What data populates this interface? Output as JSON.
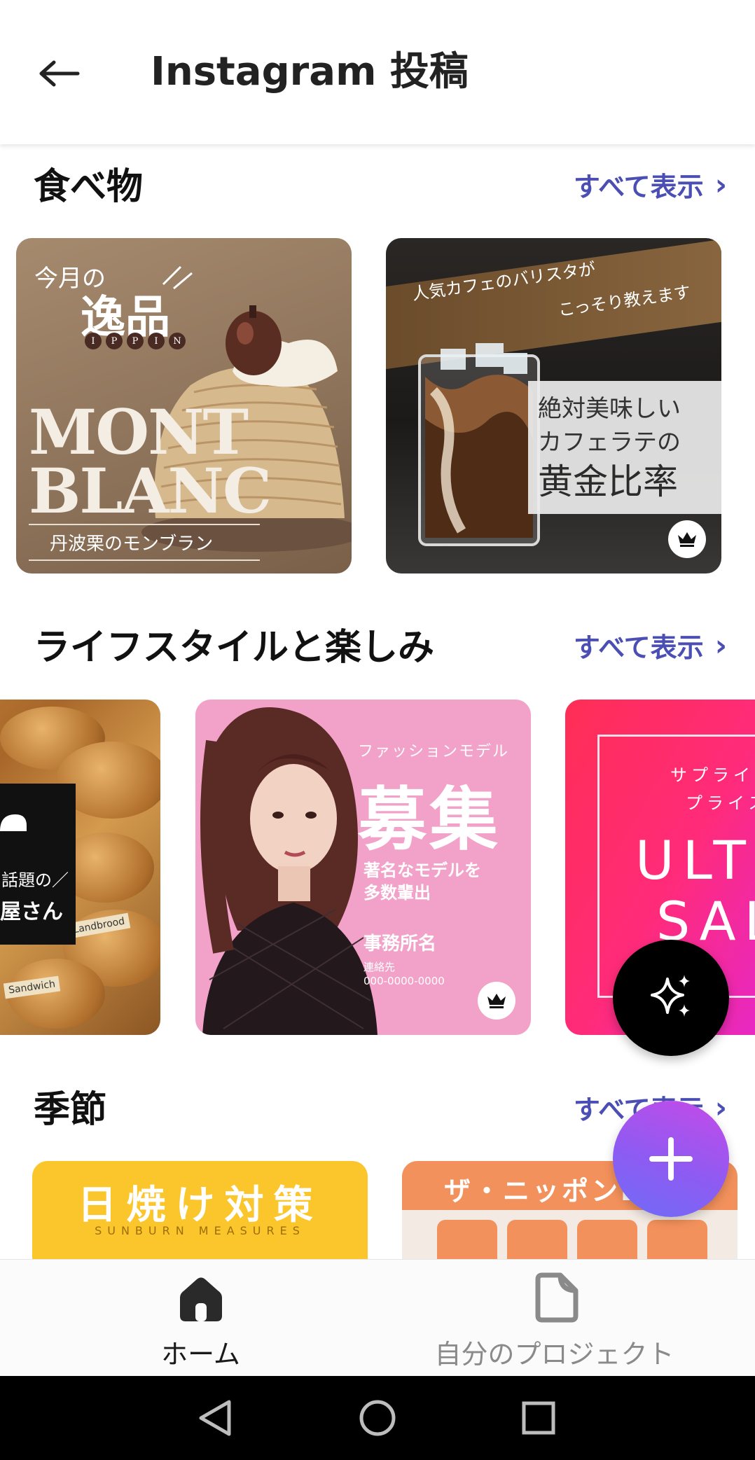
{
  "header": {
    "back_icon": "arrow-left-icon",
    "title": "Instagram 投稿"
  },
  "sections": [
    {
      "title": "食べ物",
      "see_all": "すべて表示",
      "cards": [
        {
          "kon": "今月の",
          "ippin": "逸品",
          "ippin_ro": [
            "I",
            "P",
            "P",
            "I",
            "N"
          ],
          "mont": "MONT",
          "blanc": "BLANC",
          "sub": "丹波栗のモンブラン",
          "premium": false
        },
        {
          "band_1": "人気カフェのバリスタが",
          "band_2": "こっそり教えます",
          "line_1": "絶対美味しい",
          "line_2": "カフェラテの",
          "line_3": "黄金比率",
          "premium": true
        }
      ]
    },
    {
      "title": "ライフスタイルと楽しみ",
      "see_all": "すべて表示",
      "cards": [
        {
          "line_1": "話題の／",
          "line_2": "屋さん",
          "bread_label_1": "Landbrood",
          "bread_label_2": "Sandwich",
          "premium": false
        },
        {
          "kicker": "ファッションモデル",
          "headline": "募集",
          "desc_1": "著名なモデルを",
          "desc_2": "多数輩出",
          "office": "事務所名",
          "contact_label": "連絡先",
          "contact_number": "000-0000-0000",
          "premium": true
        },
        {
          "line_1": "サプライ",
          "line_2": "プライス",
          "ult": "ULT",
          "sal": "SAL",
          "premium": false
        }
      ]
    },
    {
      "title": "季節",
      "see_all": "すべて表示",
      "cards": [
        {
          "jp": "日焼け対策",
          "en": "SUNBURN MEASURES"
        },
        {
          "title": "ザ・ニッポンB"
        }
      ]
    }
  ],
  "fabs": {
    "magic_icon": "sparkles-icon",
    "add_icon": "plus-icon"
  },
  "bottom_nav": [
    {
      "label": "ホーム",
      "icon": "home-icon",
      "active": true
    },
    {
      "label": "自分のプロジェクト",
      "icon": "document-icon",
      "active": false
    }
  ],
  "system_nav": [
    "back-triangle-icon",
    "home-circle-icon",
    "recents-square-icon"
  ],
  "colors": {
    "accent": "#4b4fb3",
    "fab_gradient_start": "#c64ae8",
    "fab_gradient_end": "#6f6cf7"
  }
}
